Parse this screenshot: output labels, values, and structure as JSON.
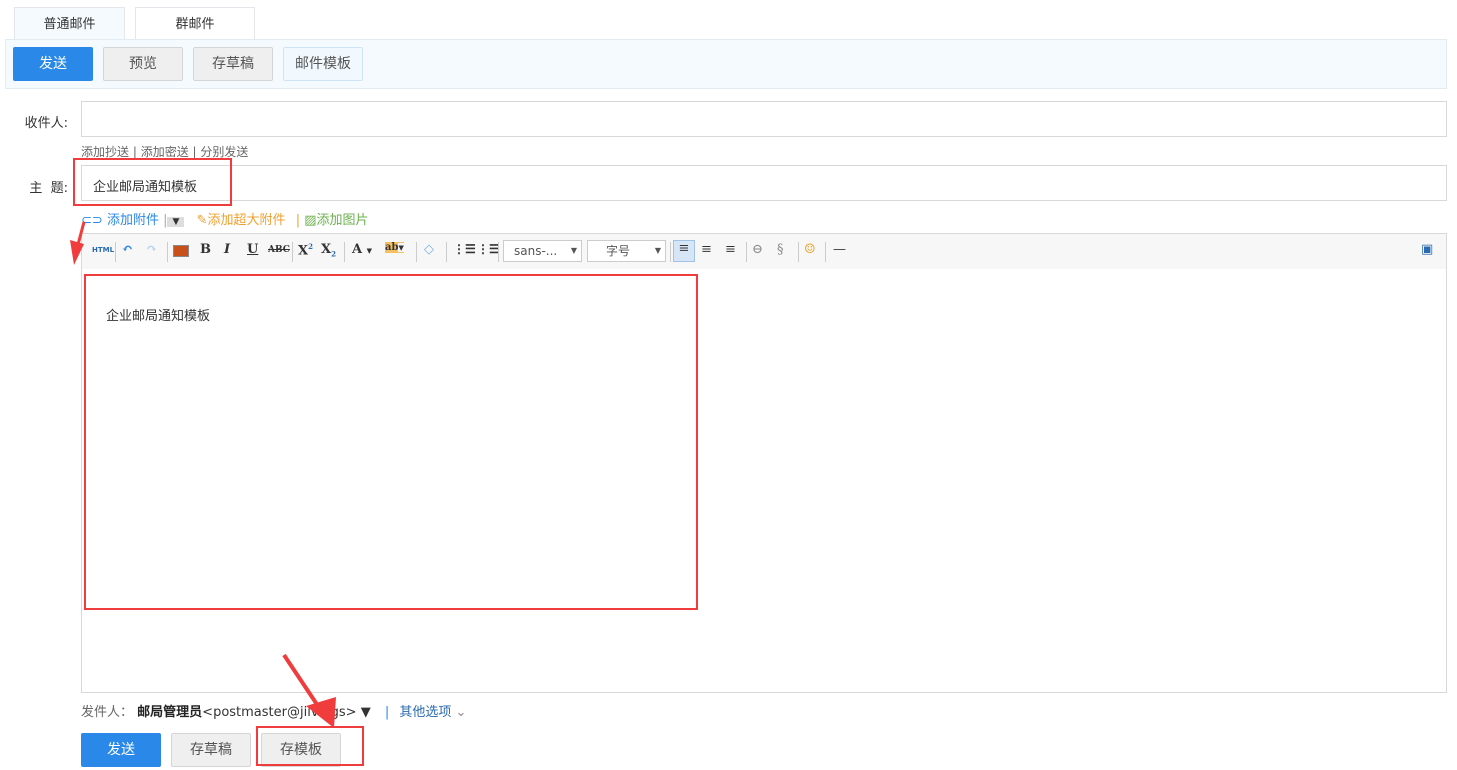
{
  "tabs": [
    {
      "label": "普通邮件",
      "active": true
    },
    {
      "label": "群邮件",
      "active": false
    }
  ],
  "toolbar": {
    "send": "发送",
    "preview": "预览",
    "save_draft": "存草稿",
    "template": "邮件模板"
  },
  "form": {
    "to_label": "收件人:",
    "to_value": "",
    "cc": "添加抄送",
    "bcc": "添加密送",
    "separate": "分别发送",
    "subject_label": "主  题:",
    "subject_value": "企业邮局通知模板"
  },
  "attach": {
    "add_attachment": "添加附件",
    "add_large": "添加超大附件",
    "add_image": "添加图片"
  },
  "editor_toolbar": {
    "html": "HTML",
    "font_family": "sans-...",
    "font_size": "字号"
  },
  "editor": {
    "body": "企业邮局通知模板"
  },
  "footer": {
    "sender_label": "发件人：",
    "sender_name": "邮局管理员",
    "sender_email": "<postmaster@jiive.gs>",
    "more_options": "其他选项",
    "send": "发送",
    "save_draft": "存草稿",
    "save_template": "存模板"
  },
  "colors": {
    "primary": "#2a88e8",
    "annotation": "#f03c3c",
    "attach_link": "#2a88e8",
    "large_attach": "#f0a030",
    "image_link": "#6ab04c"
  }
}
